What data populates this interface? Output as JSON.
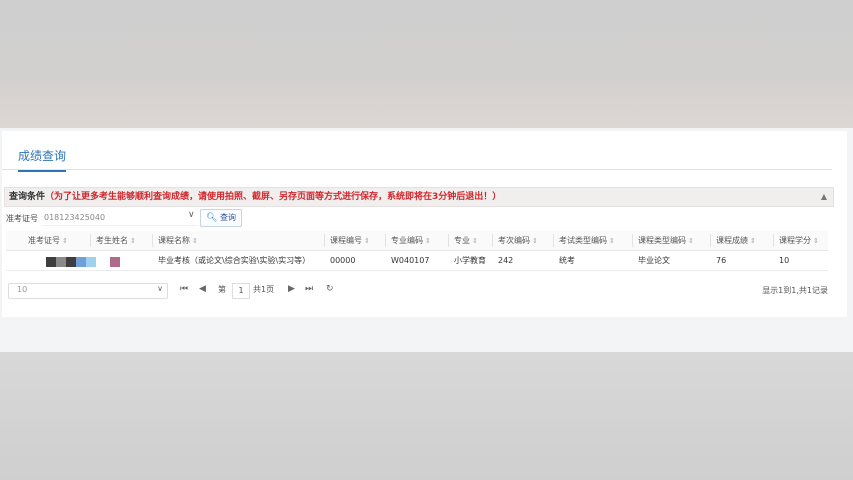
{
  "tab": {
    "label": "成绩查询"
  },
  "panel": {
    "title": "查询条件",
    "warning": "（为了让更多考生能够顺利查询成绩，请使用拍照、截屏、另存页面等方式进行保存，系统即将在3分钟后退出！）"
  },
  "search": {
    "field_label": "准考证号",
    "field_value": "018123425040",
    "button_label": "查询"
  },
  "table": {
    "columns": [
      "准考证号",
      "考生姓名",
      "课程名称",
      "课程编号",
      "专业编码",
      "专业",
      "考次编码",
      "考试类型编码",
      "课程类型编码",
      "课程成绩",
      "课程学分"
    ],
    "rows": [
      {
        "course_name": "毕业考核（或论文\\综合实验\\实验\\实习等）",
        "course_code": "00000",
        "major_code": "W040107",
        "major": "小学教育",
        "exam_code": "242",
        "exam_type": "统考",
        "course_type": "毕业论文",
        "score": "76",
        "credit": "10"
      }
    ]
  },
  "pager": {
    "page_size": "10",
    "page_prefix": "第",
    "page_number": "1",
    "page_suffix": "共1页",
    "summary": "显示1到1,共1记录"
  }
}
